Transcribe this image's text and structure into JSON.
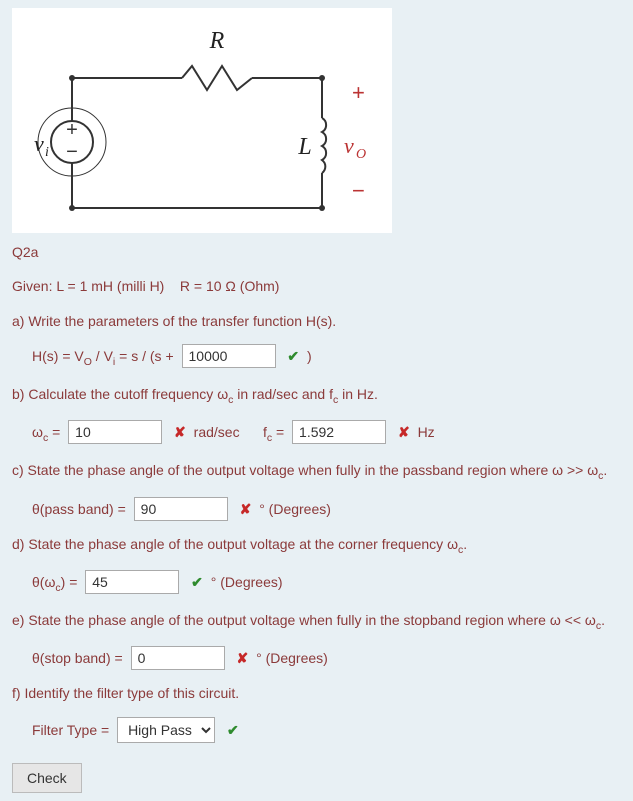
{
  "diagram": {
    "R_label": "R",
    "L_label": "L",
    "vi_label": "v",
    "vi_sub": "i",
    "vo_label": "v",
    "vo_sub": "O",
    "plus": "+",
    "minus": "−"
  },
  "q": {
    "title": "Q2a",
    "given": "Given: L = 1 mH (milli H)    R = 10 Ω (Ohm)",
    "a_prompt": "a)  Write the parameters of the transfer function H(s).",
    "a_eq_pre": "H(s) = V",
    "a_eq_pre2": " / V",
    "a_eq_pre3": " = s / (s + ",
    "a_value": "10000",
    "a_close": " )",
    "b_prompt": "b)  Calculate the cutoff frequency ω",
    "b_prompt2": " in rad/sec and f",
    "b_prompt3": " in Hz.",
    "b_wc_label": "ω",
    "b_wc_eq": " = ",
    "b_wc_value": "10",
    "b_wc_unit": "rad/sec",
    "b_fc_label": "f",
    "b_fc_eq": " = ",
    "b_fc_value": "1.592",
    "b_fc_unit": "Hz",
    "c_prompt": "c)  State the phase angle of the output voltage when fully in the passband region where ω >> ω",
    "c_prompt_end": ".",
    "c_label": "θ(pass band) = ",
    "c_value": "90",
    "c_unit": "° (Degrees)",
    "d_prompt": "d)  State the phase angle of the output voltage at the corner frequency ω",
    "d_prompt_end": ".",
    "d_label": "θ(ω",
    "d_label2": ") = ",
    "d_value": "45",
    "d_unit": "° (Degrees)",
    "e_prompt": "e)  State the phase angle of the output voltage when fully in the stopband region where ω << ω",
    "e_prompt_end": ".",
    "e_label": "θ(stop band) = ",
    "e_value": "0",
    "e_unit": "° (Degrees)",
    "f_prompt": "f)  Identify the filter type of this circuit.",
    "f_label": "Filter Type = ",
    "f_value": "High Pass",
    "check": "Check",
    "sub_O": "O",
    "sub_i": "i",
    "sub_c": "c"
  }
}
